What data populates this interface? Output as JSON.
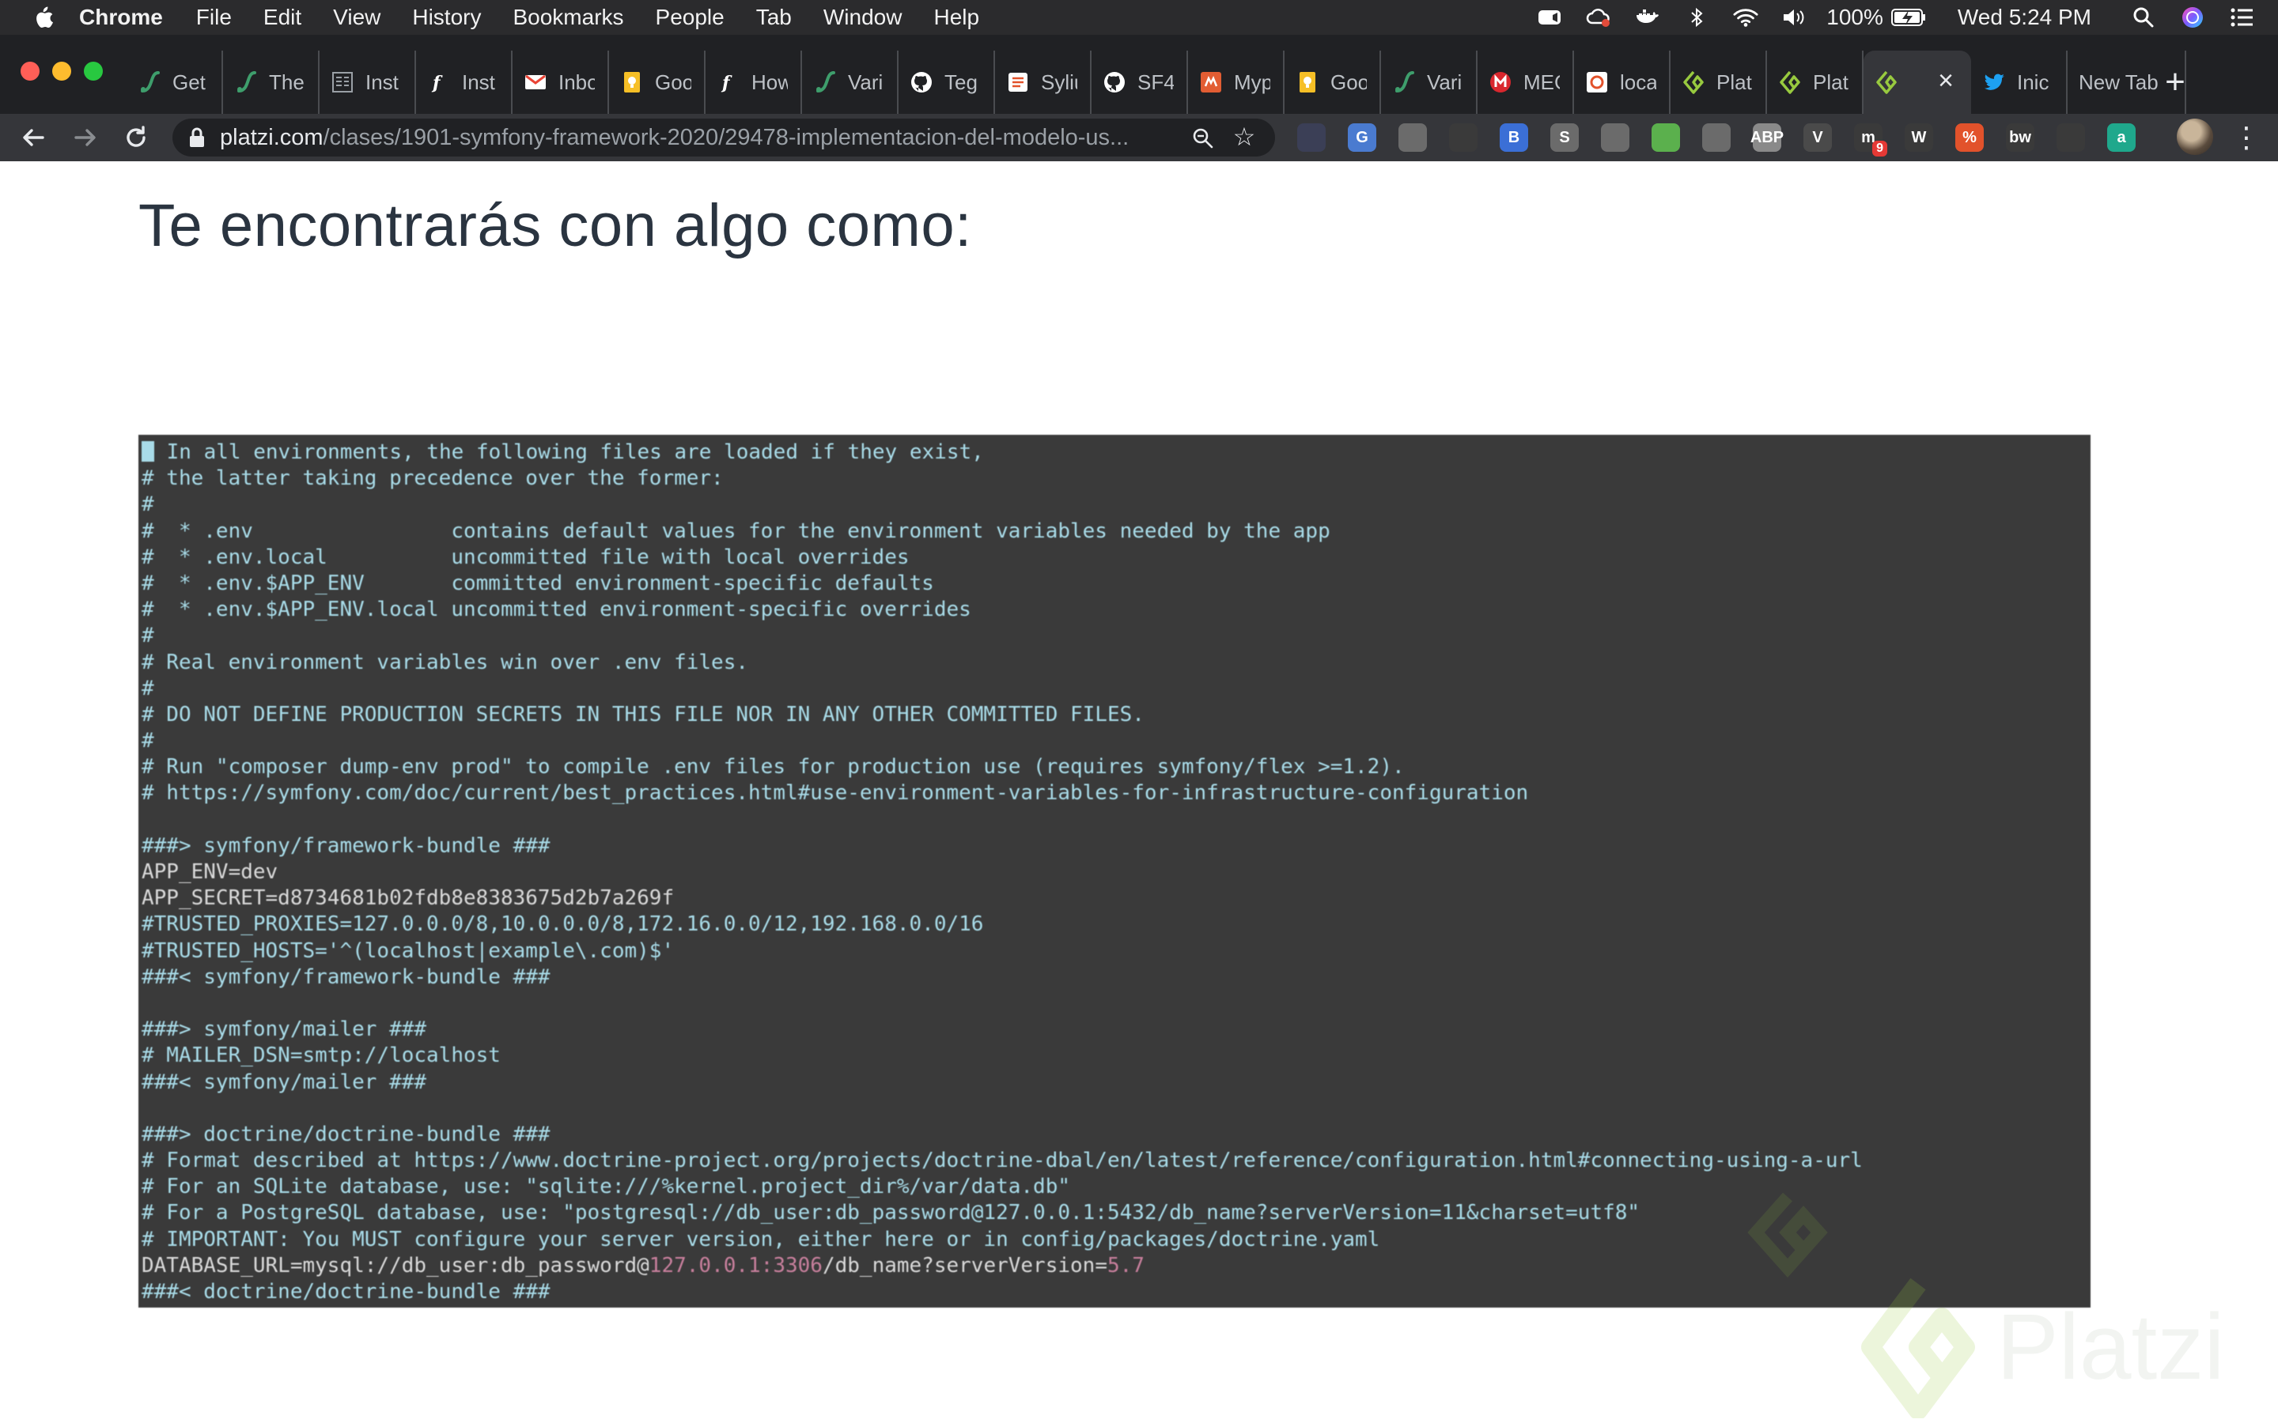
{
  "menubar": {
    "app": "Chrome",
    "items": [
      "File",
      "Edit",
      "View",
      "History",
      "Bookmarks",
      "People",
      "Tab",
      "Window",
      "Help"
    ],
    "battery": "100%",
    "clock": "Wed 5:24 PM"
  },
  "tabs": [
    {
      "title": "Get",
      "icon": "symfony-cast-icon",
      "color": "#3e9e6c"
    },
    {
      "title": "The",
      "icon": "symfony-cast-icon",
      "color": "#3e9e6c"
    },
    {
      "title": "Inst",
      "icon": "document-icon",
      "color": "#9aa0a6"
    },
    {
      "title": "Inst",
      "icon": "symfony-icon",
      "color": "#ffffff"
    },
    {
      "title": "Inbox",
      "icon": "gmail-icon",
      "color": "#ea4335"
    },
    {
      "title": "Goo",
      "icon": "keep-icon",
      "color": "#f6bf26"
    },
    {
      "title": "How",
      "icon": "symfony-icon",
      "color": "#ffffff"
    },
    {
      "title": "Vari",
      "icon": "symfony-cast-icon",
      "color": "#3e9e6c"
    },
    {
      "title": "Teg",
      "icon": "github-icon",
      "color": "#ffffff"
    },
    {
      "title": "Sylius",
      "icon": "sylius-icon",
      "color": "#ffffff"
    },
    {
      "title": "SF4",
      "icon": "github-icon",
      "color": "#ffffff"
    },
    {
      "title": "Myp",
      "icon": "myp-icon",
      "color": "#e25d33"
    },
    {
      "title": "Goo",
      "icon": "keep-icon",
      "color": "#f6bf26"
    },
    {
      "title": "Vari",
      "icon": "symfony-cast-icon",
      "color": "#3e9e6c"
    },
    {
      "title": "MEG",
      "icon": "mega-icon",
      "color": "#d9272e"
    },
    {
      "title": "loca",
      "icon": "local-icon",
      "color": "#ffffff"
    },
    {
      "title": "Plat",
      "icon": "platzi-icon",
      "color": "#98ca3f"
    },
    {
      "title": "Plat",
      "icon": "platzi-icon",
      "color": "#98ca3f"
    },
    {
      "title": "",
      "icon": "platzi-icon",
      "color": "#98ca3f",
      "active": true
    },
    {
      "title": "Inic",
      "icon": "twitter-icon",
      "color": "#1da1f2"
    },
    {
      "title": "New Tab",
      "icon": "",
      "color": ""
    }
  ],
  "omnibox": {
    "host": "platzi.com",
    "path": "/clases/1901-symfony-framework-2020/29478-implementacion-del-modelo-us..."
  },
  "extensions": [
    {
      "name": "privacy-extension-icon",
      "color": "#3b3f56",
      "label": ""
    },
    {
      "name": "google-translate-icon",
      "color": "#4a7bd0",
      "label": "G"
    },
    {
      "name": "tools-extension-icon",
      "color": "#6b6b6b",
      "label": ""
    },
    {
      "name": "react-devtools-icon",
      "color": "#3a3a3a",
      "label": ""
    },
    {
      "name": "bookmark-extension-icon",
      "color": "#3b6fd6",
      "label": "B"
    },
    {
      "name": "skype-extension-icon",
      "color": "#6b6b6b",
      "label": "S"
    },
    {
      "name": "target-extension-icon",
      "color": "#6b6b6b",
      "label": ""
    },
    {
      "name": "mail-extension-icon",
      "color": "#5bb04d",
      "label": ""
    },
    {
      "name": "emoji-extension-icon",
      "color": "#6b6b6b",
      "label": ""
    },
    {
      "name": "adblock-plus-icon",
      "color": "#8a8a8a",
      "label": "ABP"
    },
    {
      "name": "vue-devtools-icon",
      "color": "#4a4a4a",
      "label": "V"
    },
    {
      "name": "mercury-extension-icon",
      "color": "#3a3a3a",
      "label": "m",
      "badge": "9"
    },
    {
      "name": "wordpress-extension-icon",
      "color": "#3a3a3a",
      "label": "W"
    },
    {
      "name": "percent-extension-icon",
      "color": "#e2522b",
      "label": "%"
    },
    {
      "name": "bw-extension-icon",
      "color": "#3a3a3a",
      "label": "bw"
    },
    {
      "name": "feather-extension-icon",
      "color": "#3a3a3a",
      "label": ""
    },
    {
      "name": "amazon-assistant-icon",
      "color": "#1fa88c",
      "label": "a"
    }
  ],
  "page": {
    "heading": "Te encontrarás con algo como:"
  },
  "terminal": {
    "lines": [
      {
        "kind": "cmt",
        "text": "# In all environments, the following files are loaded if they exist,"
      },
      {
        "kind": "cmt",
        "text": "# the latter taking precedence over the former:"
      },
      {
        "kind": "cmt",
        "text": "#"
      },
      {
        "kind": "cmt",
        "text": "#  * .env                contains default values for the environment variables needed by the app"
      },
      {
        "kind": "cmt",
        "text": "#  * .env.local          uncommitted file with local overrides"
      },
      {
        "kind": "cmt",
        "text": "#  * .env.$APP_ENV       committed environment-specific defaults"
      },
      {
        "kind": "cmt",
        "text": "#  * .env.$APP_ENV.local uncommitted environment-specific overrides"
      },
      {
        "kind": "cmt",
        "text": "#"
      },
      {
        "kind": "cmt",
        "text": "# Real environment variables win over .env files."
      },
      {
        "kind": "cmt",
        "text": "#"
      },
      {
        "kind": "cmt",
        "text": "# DO NOT DEFINE PRODUCTION SECRETS IN THIS FILE NOR IN ANY OTHER COMMITTED FILES."
      },
      {
        "kind": "cmt",
        "text": "#"
      },
      {
        "kind": "cmt",
        "text": "# Run \"composer dump-env prod\" to compile .env files for production use (requires symfony/flex >=1.2)."
      },
      {
        "kind": "cmt",
        "text": "# https://symfony.com/doc/current/best_practices.html#use-environment-variables-for-infrastructure-configuration"
      },
      {
        "kind": "blank",
        "text": ""
      },
      {
        "kind": "cmt",
        "text": "###> symfony/framework-bundle ###"
      },
      {
        "kind": "var",
        "text": "APP_ENV=dev"
      },
      {
        "kind": "var",
        "text": "APP_SECRET=d8734681b02fdb8e8383675d2b7a269f"
      },
      {
        "kind": "cmt",
        "text": "#TRUSTED_PROXIES=127.0.0.0/8,10.0.0.0/8,172.16.0.0/12,192.168.0.0/16"
      },
      {
        "kind": "cmt",
        "text": "#TRUSTED_HOSTS='^(localhost|example\\.com)$'"
      },
      {
        "kind": "cmt",
        "text": "###< symfony/framework-bundle ###"
      },
      {
        "kind": "blank",
        "text": ""
      },
      {
        "kind": "cmt",
        "text": "###> symfony/mailer ###"
      },
      {
        "kind": "cmt",
        "text": "# MAILER_DSN=smtp://localhost"
      },
      {
        "kind": "cmt",
        "text": "###< symfony/mailer ###"
      },
      {
        "kind": "blank",
        "text": ""
      },
      {
        "kind": "cmt",
        "text": "###> doctrine/doctrine-bundle ###"
      },
      {
        "kind": "cmt",
        "text": "# Format described at https://www.doctrine-project.org/projects/doctrine-dbal/en/latest/reference/configuration.html#connecting-using-a-url"
      },
      {
        "kind": "cmt",
        "text": "# For an SQLite database, use: \"sqlite:///%kernel.project_dir%/var/data.db\""
      },
      {
        "kind": "cmt",
        "text": "# For a PostgreSQL database, use: \"postgresql://db_user:db_password@127.0.0.1:5432/db_name?serverVersion=11&charset=utf8\""
      },
      {
        "kind": "cmt",
        "text": "# IMPORTANT: You MUST configure your server version, either here or in config/packages/doctrine.yaml"
      },
      {
        "kind": "var",
        "text": "DATABASE_URL=mysql://db_user:db_password@",
        "pink": "127.0.0.1:3306",
        "rest": "/db_name?serverVersion=",
        "pink2": "5.7"
      },
      {
        "kind": "cmt",
        "text": "###< doctrine/doctrine-bundle ###"
      }
    ]
  },
  "watermark": {
    "word": "Platzi"
  },
  "colors": {
    "terminal_bg": "#3a3a3a",
    "comment": "#a8dbe8",
    "heading": "#2a3440",
    "platzi_green": "#98ca3f"
  }
}
